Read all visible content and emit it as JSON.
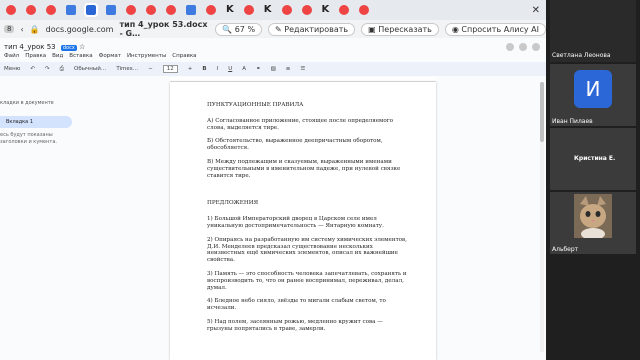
{
  "browser": {
    "tab_k_glyphs": [
      "K",
      "K",
      "K"
    ],
    "address": "docs.google.com",
    "page_title": "тип 4_урок 53.docx - G…",
    "zoom": "67 %",
    "edit_button": "Редактировать",
    "retell_button": "Пересказать",
    "alice_button": "Спросить Алису AI",
    "tab_count": "8"
  },
  "doc": {
    "title": "тип 4_урок 53",
    "badge": "docx",
    "menu": [
      "Файл",
      "Правка",
      "Вид",
      "Вставка",
      "Формат",
      "Инструменты",
      "Справка"
    ],
    "toolbar": {
      "mode": "Меню",
      "style": "Обычный…",
      "font": "Times…",
      "size": "12"
    }
  },
  "outline": {
    "header": "кладки в документе",
    "tab1": "Вкладка 1",
    "note": "есь будут показаны заголовки и кумента."
  },
  "content": {
    "heading1": "ПУНКТУАЦИОННЫЕ ПРАВИЛА",
    "ruleA": "А) Согласованное приложение, стоящее после определяемого слова, выделяется тире.",
    "ruleB": "Б) Обстоятельство, выраженное деепричастным оборотом, обособляется.",
    "ruleV": "В) Между подлежащим и сказуемым, выраженными именами существительными в именительном падеже, при нулевой связке ставится тире.",
    "heading2": "ПРЕДЛОЖЕНИЯ",
    "s1": "1) Большой Императорский дворец в Царском селе имел уникальную достопримечательность — Янтарную комнату.",
    "s2": "2) Опираясь на разработанную им систему химических элементов, Д.И. Менделеев предсказал существование нескольких неизвестных ещё химических элементов, описал их важнейшие свойства.",
    "s3": "3) Память — это способность человека запечатлевать, сохранять и воспроизводить то, что он ранее воспринимал, переживал, делал, думал.",
    "s4": "4) Бледное небо сияло, звёзды то мигали слабым светом, то исчезали.",
    "s5": "5) Над полем, засеянным рожью, медленно кружит сова — грызуны попрятались в траве, замерли."
  },
  "participants": {
    "top_name": "Светлана Леонова",
    "ivan_initial": "И",
    "ivan_name": "Иван Пилаев",
    "kristina_name": "Кристина Е.",
    "albert_name": "Альберт"
  },
  "colors": {
    "accent": "#1a73e8",
    "avatar": "#2b67d6",
    "tab_red": "#e44444"
  }
}
